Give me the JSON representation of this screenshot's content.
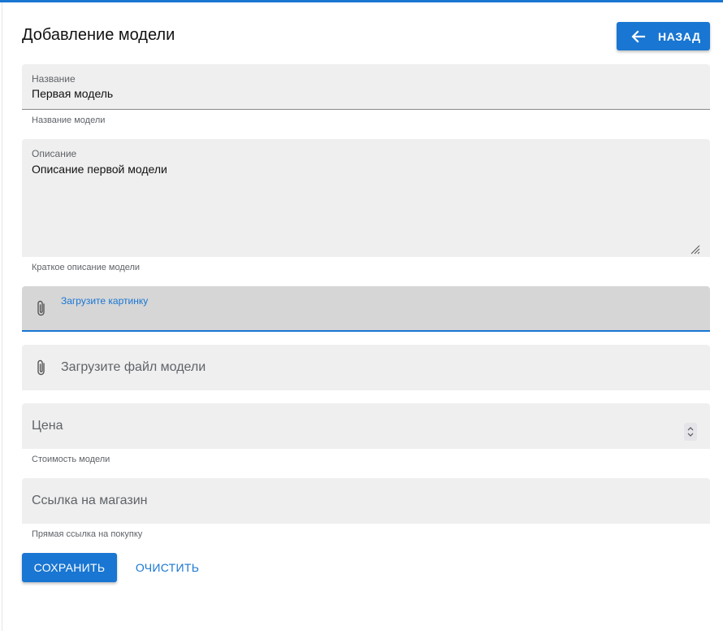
{
  "header": {
    "title": "Добавление модели",
    "back_label": "НАЗАД"
  },
  "form": {
    "name": {
      "label": "Название",
      "value": "Первая модель",
      "hint": "Название модели"
    },
    "description": {
      "label": "Описание",
      "value": "Описание первой модели",
      "hint": "Краткое описание модели"
    },
    "image": {
      "label": "Загрузите картинку"
    },
    "model_file": {
      "placeholder": "Загрузите файл модели"
    },
    "price": {
      "placeholder": "Цена",
      "hint": "Стоимость модели"
    },
    "shop_link": {
      "placeholder": "Ссылка на магазин",
      "hint": "Прямая ссылка на покупку"
    }
  },
  "actions": {
    "save_label": "СОХРАНИТЬ",
    "clear_label": "ОЧИСТИТЬ"
  },
  "colors": {
    "accent": "#1976d2",
    "field_bg": "#efefef",
    "field_focused_bg": "#d6d6d6"
  },
  "icons": [
    "arrow-left-icon",
    "paperclip-icon",
    "resize-handle-icon",
    "spinner-icon"
  ]
}
